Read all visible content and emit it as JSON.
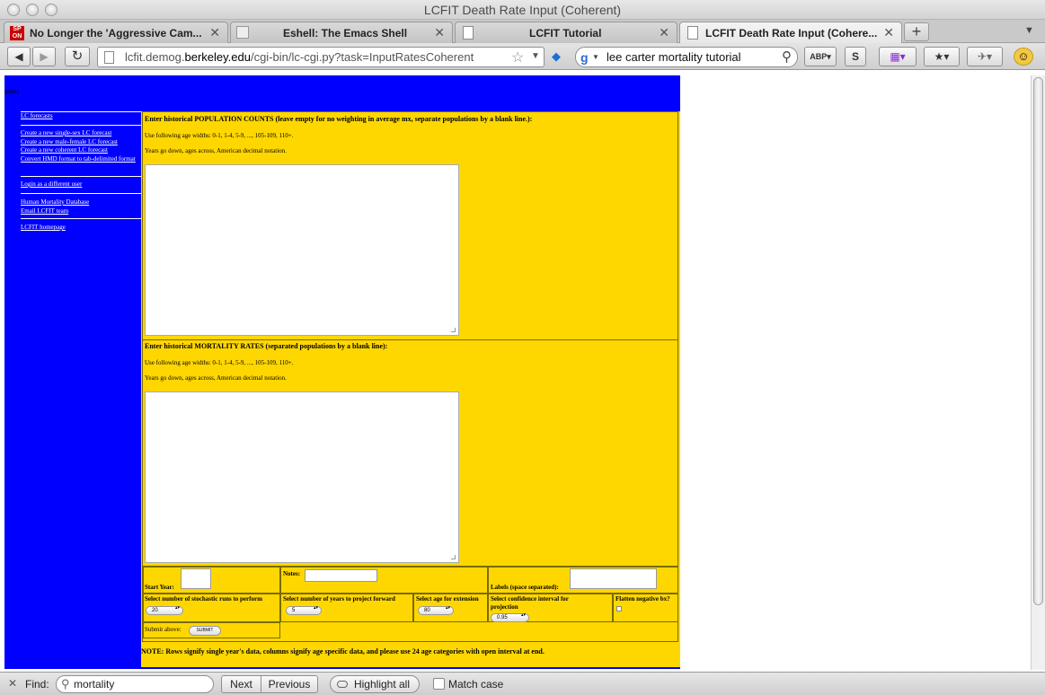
{
  "window": {
    "title": "LCFIT Death Rate Input (Coherent)"
  },
  "tabs": [
    {
      "label": "No Longer the 'Aggressive Cam..."
    },
    {
      "label": "Eshell: The Emacs Shell"
    },
    {
      "label": "LCFIT Tutorial"
    },
    {
      "label": "LCFIT Death Rate Input (Cohere..."
    }
  ],
  "nav": {
    "url_prefix": "lcfit.demog.",
    "url_domain": "berkeley.edu",
    "url_path": "/cgi-bin/lc-cgi.py?task=InputRatesCoherent",
    "search_query": "lee carter mortality tutorial"
  },
  "page": {
    "header_text": "nodes",
    "sidebar": {
      "group1": [
        "LC forecasts"
      ],
      "group2": [
        "Create a new single-sex LC forecast",
        "Create a new male-female LC forecast",
        "Create a new coherent LC forecast",
        "Convert HMD format to tab-delimited format"
      ],
      "group3": [
        "Login as a different user"
      ],
      "group4": [
        "Human Mortality Database",
        "Email LCFIT team"
      ],
      "group5": [
        "LCFIT homepage"
      ]
    },
    "population": {
      "heading": "Enter historical POPULATION COUNTS (leave empty for no weighting in average mx, separate populations by a blank line.):",
      "age_note": "Use following age widths: 0-1, 1-4, 5-9, ..., 105-109, 110+.",
      "year_note": "Years go down, ages across, American decimal notation."
    },
    "mortality": {
      "heading": "Enter historical MORTALITY RATES (separated populations by a blank line):",
      "age_note": "Use following age widths: 0-1, 1-4, 5-9, ..., 105-109, 110+.",
      "year_note": "Years go down, ages across, American decimal notation."
    },
    "params": {
      "start_year_label": "Start Year:",
      "notes_label": "Notes:",
      "labels_label": "Labels (space separated):",
      "runs_label": "Select number of stochastic runs to perform",
      "runs_value": "20",
      "years_label": "Select number of years to project forward",
      "years_value": "5",
      "ext_label": "Select age for extension",
      "ext_value": "80",
      "ci_label": "Select confidence interval for projection",
      "ci_value": "0.95",
      "flatten_label": "Flatten negative bx?",
      "submit_label": "Submit above:",
      "submit_button": "SUBMIT"
    },
    "note": "NOTE: Rows signify single year's data, columns signify age specific data, and please use 24 age categories with open interval at end."
  },
  "findbar": {
    "label": "Find:",
    "query": "mortality",
    "next": "Next",
    "previous": "Previous",
    "highlight": "Highlight all",
    "match_case": "Match case"
  }
}
